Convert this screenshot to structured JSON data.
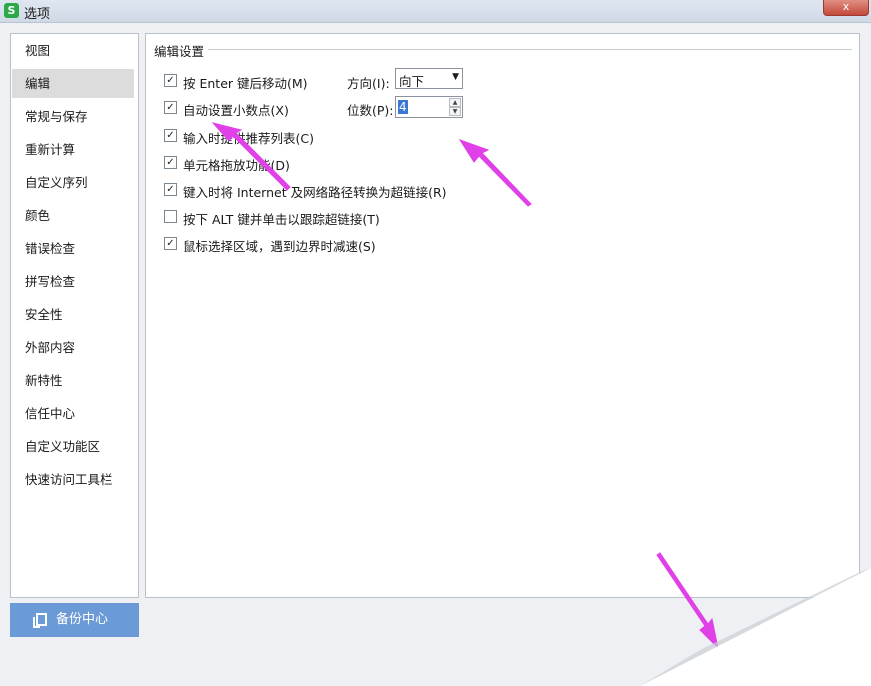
{
  "window": {
    "title": "选项",
    "app_icon_letter": "S",
    "close_glyph": "x"
  },
  "sidebar": {
    "items": [
      {
        "label": "视图"
      },
      {
        "label": "编辑"
      },
      {
        "label": "常规与保存"
      },
      {
        "label": "重新计算"
      },
      {
        "label": "自定义序列"
      },
      {
        "label": "颜色"
      },
      {
        "label": "错误检查"
      },
      {
        "label": "拼写检查"
      },
      {
        "label": "安全性"
      },
      {
        "label": "外部内容"
      },
      {
        "label": "新特性"
      },
      {
        "label": "信任中心"
      },
      {
        "label": "自定义功能区"
      },
      {
        "label": "快速访问工具栏"
      }
    ],
    "selected": "编辑"
  },
  "backup_button": {
    "label": "备份中心"
  },
  "edit_settings": {
    "section_title": "编辑设置",
    "options": [
      {
        "label": "按 Enter 键后移动(M)",
        "checked": true
      },
      {
        "label": "自动设置小数点(X)",
        "checked": true
      },
      {
        "label": "输入时提供推荐列表(C)",
        "checked": true
      },
      {
        "label": "单元格拖放功能(D)",
        "checked": true
      },
      {
        "label": "键入时将 Internet 及网络路径转换为超链接(R)",
        "checked": true
      },
      {
        "label": "按下 ALT 键并单击以跟踪超链接(T)",
        "checked": false
      },
      {
        "label": "鼠标选择区域，遇到边界时减速(S)",
        "checked": true
      }
    ],
    "direction": {
      "label": "方向(I):",
      "value": "向下"
    },
    "places": {
      "label": "位数(P):",
      "value": "4"
    }
  },
  "colors": {
    "annotation_arrow": "#e040e8",
    "backup_button": "#6b9bd6",
    "selected_item": "#dcdcdc"
  },
  "icons": {
    "checkmark": "✓",
    "dropdown": "▼",
    "spin_up": "▲",
    "spin_down": "▼",
    "backup": "backup-icon"
  }
}
